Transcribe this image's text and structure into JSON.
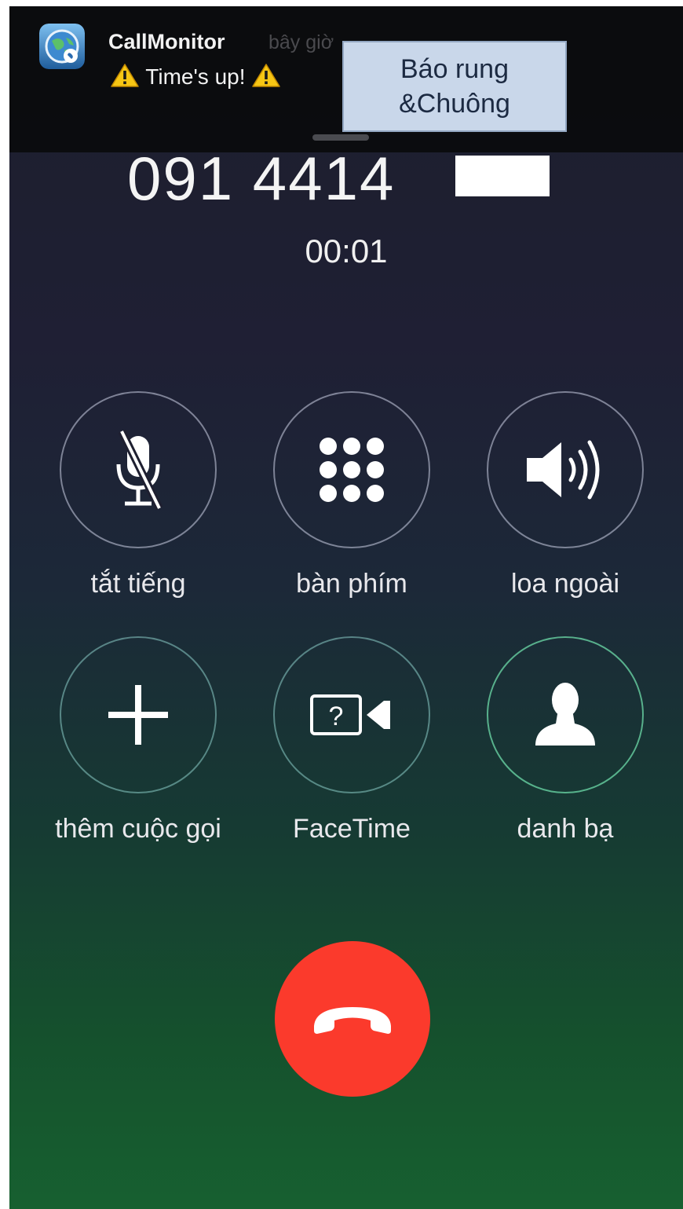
{
  "notification": {
    "app_name": "CallMonitor",
    "time": "bây giờ",
    "message": "Time's up!",
    "icons": [
      "app-globe-icon",
      "warning-icon"
    ]
  },
  "popup": {
    "line1": "Báo rung",
    "line2": "&Chuông"
  },
  "call": {
    "number": "091 4414",
    "duration": "00:01"
  },
  "controls": [
    {
      "label": "tắt tiếng",
      "icon": "mute-mic-icon"
    },
    {
      "label": "bàn phím",
      "icon": "keypad-icon"
    },
    {
      "label": "loa ngoài",
      "icon": "speaker-icon"
    },
    {
      "label": "thêm cuộc gọi",
      "icon": "plus-icon"
    },
    {
      "label": "FaceTime",
      "icon": "facetime-icon"
    },
    {
      "label": "danh bạ",
      "icon": "contact-icon"
    }
  ],
  "end_call": {
    "icon": "end-call-icon"
  },
  "colors": {
    "end_call": "#fb3a2c",
    "popup_bg": "#c9d7ea",
    "banner_bg": "#0a0b0e"
  }
}
